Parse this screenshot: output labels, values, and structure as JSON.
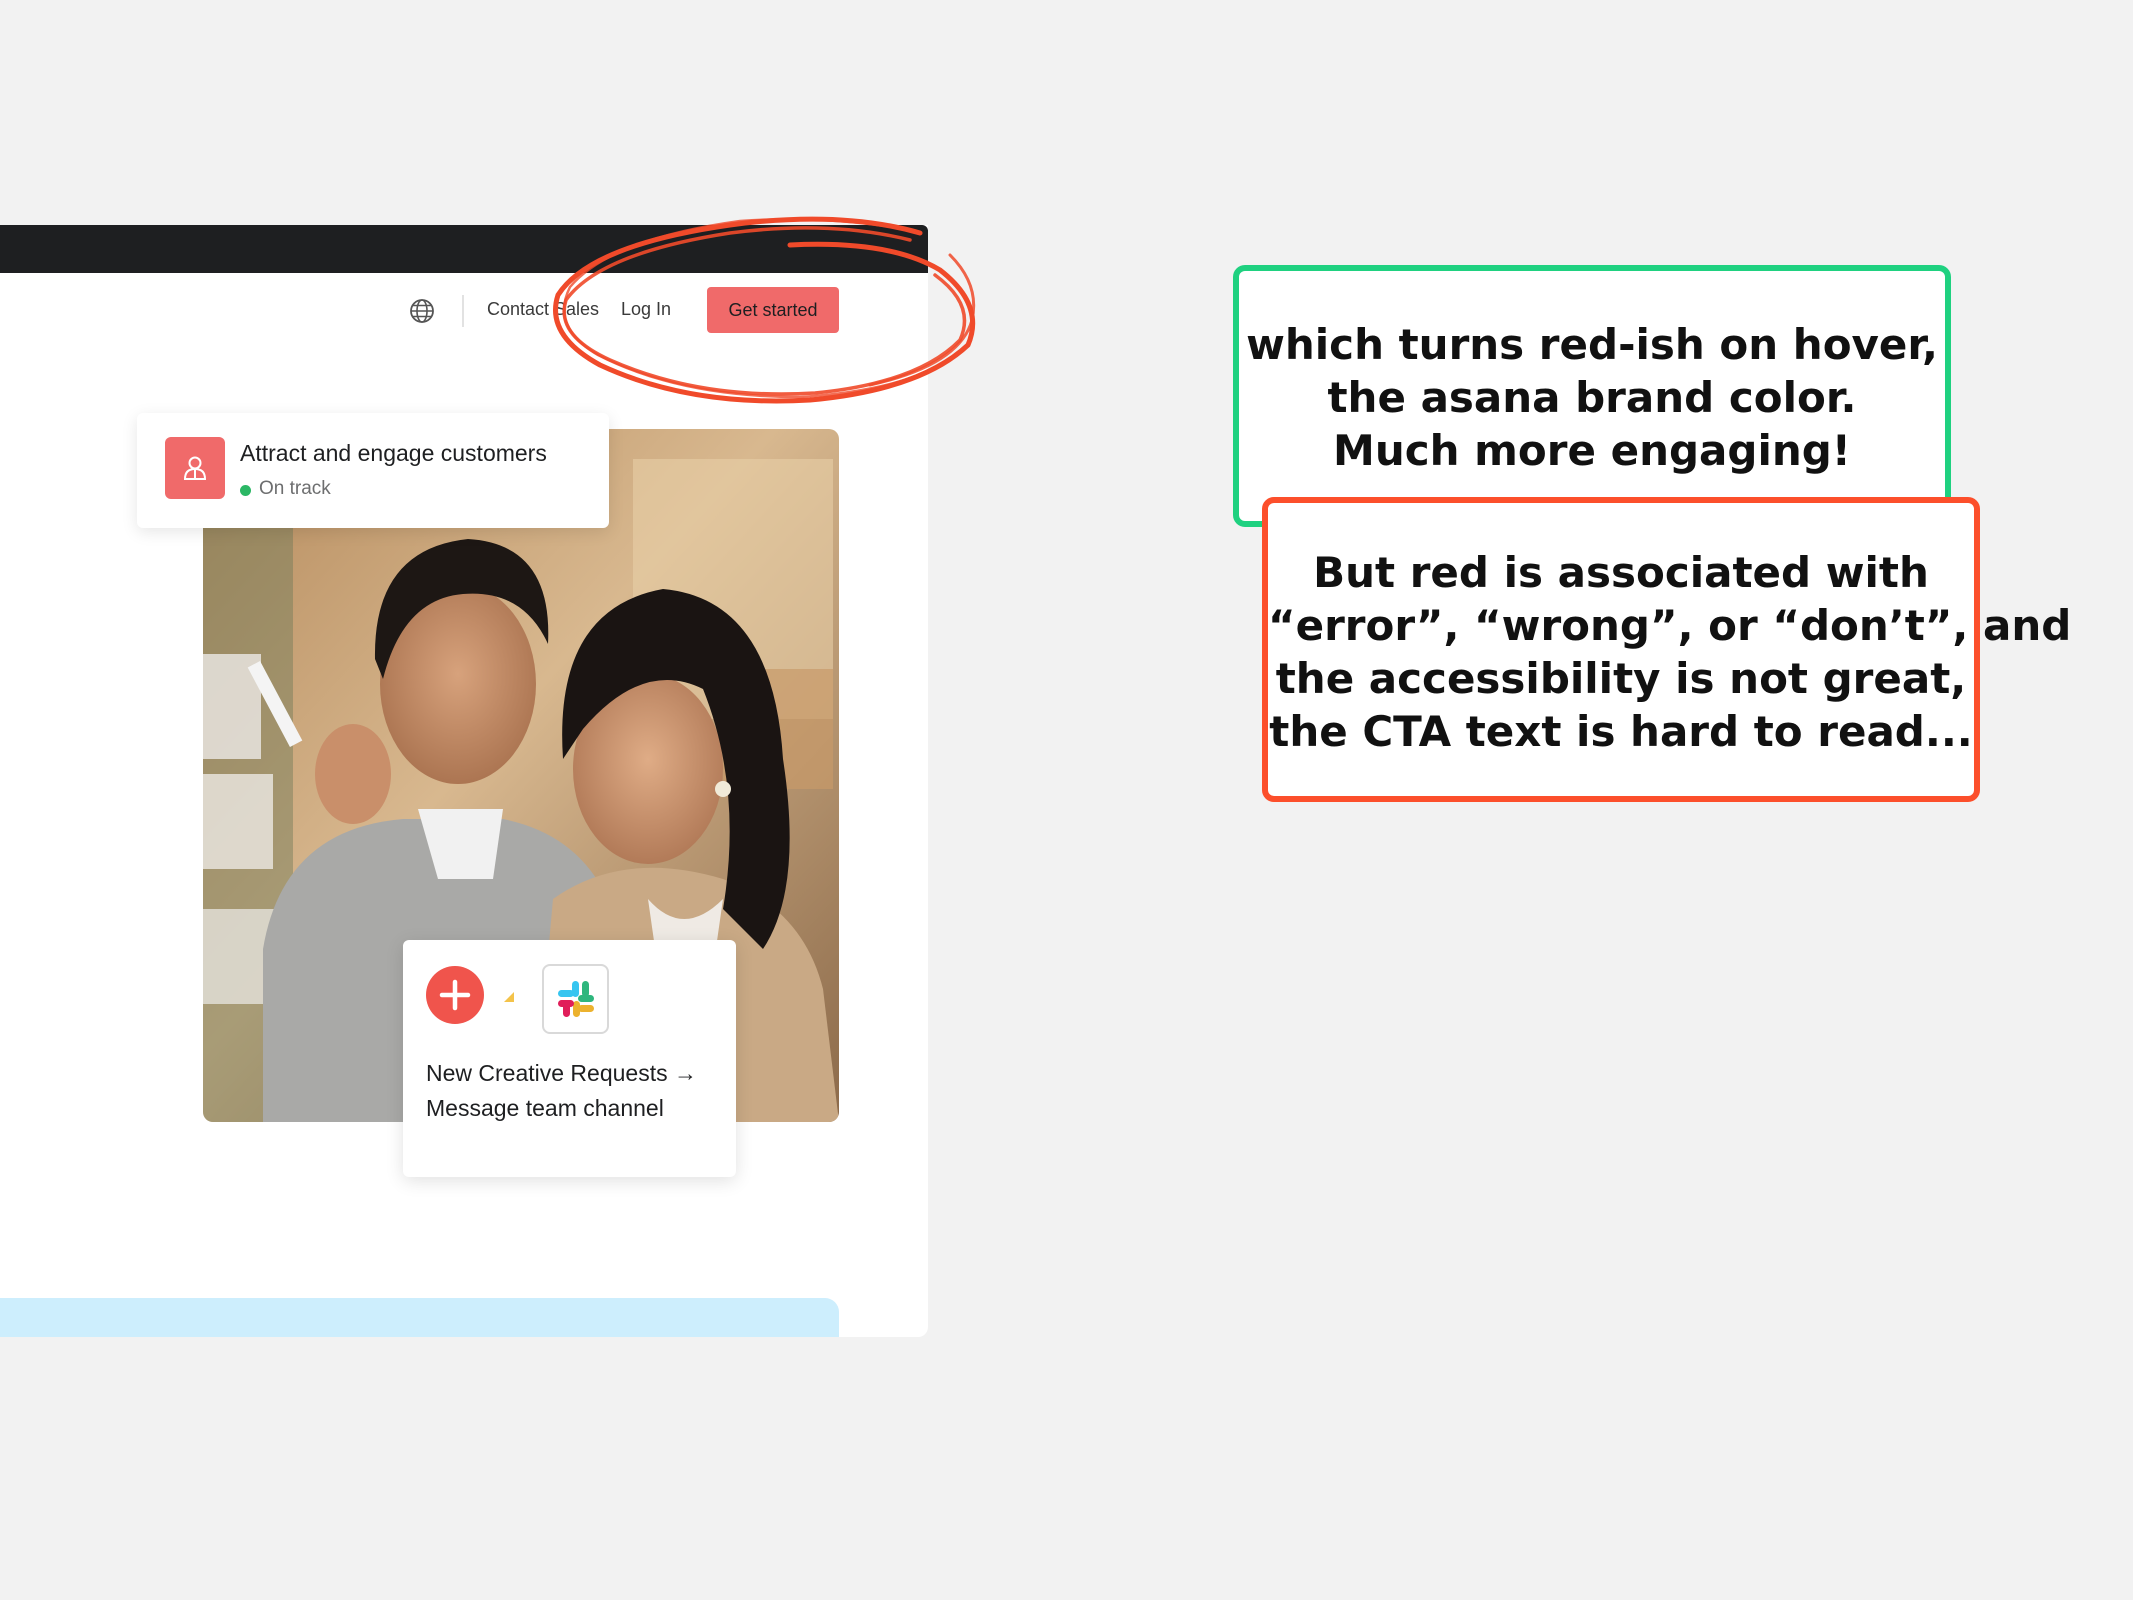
{
  "nav": {
    "contact_label": "Contact Sales",
    "login_label": "Log In",
    "cta_label": "Get started"
  },
  "status_card": {
    "title": "Attract and engage customers",
    "status": "On track"
  },
  "integration_card": {
    "line1": "New Creative Requests →",
    "line2": "Message team channel"
  },
  "callouts": {
    "green": [
      "which turns red-ish on hover,",
      "the asana brand color.",
      "Much more engaging!"
    ],
    "red": [
      "But red is associated with",
      "“error”, “wrong”, or “don’t”, and",
      "the accessibility is not great,",
      "the CTA text is hard to read..."
    ]
  },
  "colors": {
    "cta": "#f06a6a",
    "brand_red": "#f0544c",
    "green_border": "#1fd180",
    "red_border": "#fc4f2b",
    "on_track_dot": "#2bb765"
  },
  "icons": [
    "globe-icon",
    "people-icon",
    "plus-icon",
    "slack-icon"
  ]
}
